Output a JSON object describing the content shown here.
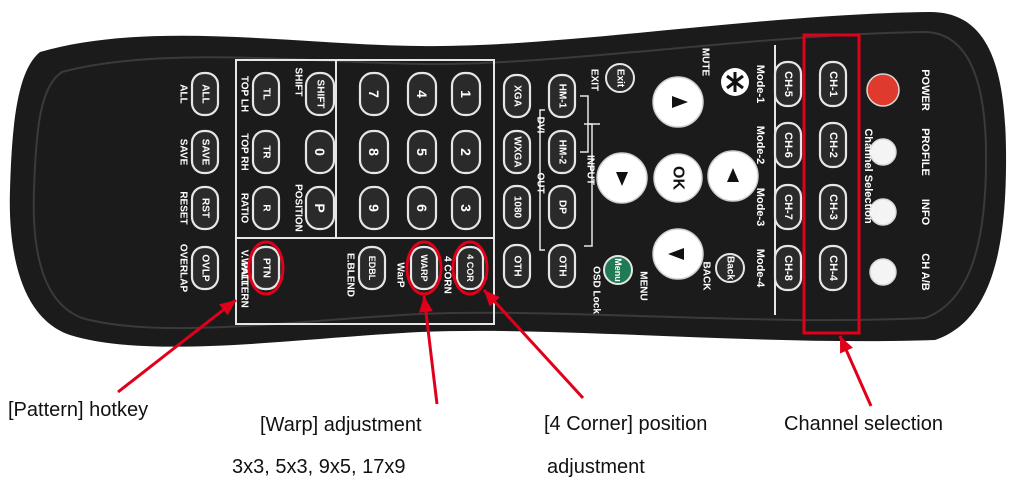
{
  "remote": {
    "top_row": [
      {
        "id": "power",
        "label": "POWER",
        "kind": "round-red"
      },
      {
        "id": "profile",
        "label": "PROFILE",
        "kind": "round-white"
      },
      {
        "id": "info",
        "label": "INFO",
        "kind": "round-white"
      },
      {
        "id": "chab",
        "label": "CH A/B",
        "kind": "round-white"
      }
    ],
    "channel_buttons": [
      {
        "id": "ch1",
        "label": "CH-1"
      },
      {
        "id": "ch2",
        "label": "CH-2"
      },
      {
        "id": "ch3",
        "label": "CH-3"
      },
      {
        "id": "ch4",
        "label": "CH-4"
      }
    ],
    "channel_selection_label": "Channel Selection",
    "mode_buttons": [
      {
        "id": "ch5",
        "label": "CH-5",
        "mode": "Mode-1"
      },
      {
        "id": "ch6",
        "label": "CH-6",
        "mode": "Mode-2"
      },
      {
        "id": "ch7",
        "label": "CH-7",
        "mode": "Mode-3"
      },
      {
        "id": "ch8",
        "label": "CH-8",
        "mode": "Mode-4"
      }
    ],
    "mute": {
      "label": "MUTE"
    },
    "exit": {
      "btn": "Exit",
      "label": "EXIT"
    },
    "back": {
      "btn": "Back",
      "label": "BACK"
    },
    "menu": {
      "btn": "Menu",
      "label": "MENU"
    },
    "osd_lock_label": "OSD Lock",
    "ok": "OK",
    "input_label": "INPUT",
    "dvi_label": "DVI",
    "out_label": "OUT",
    "input_buttons": [
      {
        "id": "hm1",
        "label": "HM-1"
      },
      {
        "id": "hm2",
        "label": "HM-2"
      },
      {
        "id": "dp",
        "label": "DP"
      },
      {
        "id": "oth_in",
        "label": "OTH"
      }
    ],
    "output_buttons": [
      {
        "id": "xga",
        "label": "XGA"
      },
      {
        "id": "wxga",
        "label": "WXGA"
      },
      {
        "id": "p1080",
        "label": "1080"
      },
      {
        "id": "oth_out",
        "label": "OTH"
      }
    ],
    "numbers": [
      [
        "1",
        "2",
        "3"
      ],
      [
        "4",
        "5",
        "6"
      ],
      [
        "7",
        "8",
        "9"
      ],
      [
        "SHIFT",
        "0",
        "P"
      ]
    ],
    "function_keys": [
      {
        "id": "tl",
        "btn": "TL",
        "label": "TOP LH"
      },
      {
        "id": "tr",
        "btn": "TR",
        "label": "TOP RH"
      },
      {
        "id": "r",
        "btn": "R",
        "label": "RATIO"
      },
      {
        "id": "vw",
        "btn": "VW",
        "label": "V.WALL"
      }
    ],
    "shift_label": "SHIFT",
    "position_label": "POSITION",
    "bottom_keys": [
      {
        "id": "all",
        "btn": "ALL",
        "label": "ALL"
      },
      {
        "id": "save",
        "btn": "SAVE",
        "label": "SAVE"
      },
      {
        "id": "rst",
        "btn": "RST",
        "label": "RESET"
      },
      {
        "id": "ovlp",
        "btn": "OVLP",
        "label": "OVERLAP"
      }
    ],
    "warp_keys": [
      {
        "id": "cor",
        "btn": "4 COR",
        "label": "4 CORN"
      },
      {
        "id": "warp",
        "btn": "WARP",
        "label": "WarP"
      },
      {
        "id": "edbl",
        "btn": "EDBL",
        "label": "E.BLEND"
      },
      {
        "id": "ptn",
        "btn": "PTN",
        "label": "PATTERN"
      }
    ]
  },
  "callouts": {
    "pattern": "[Pattern] hotkey",
    "warp_line1": "[Warp] adjustment",
    "warp_line2": "3x3, 5x3, 9x5, 17x9",
    "corner_line1": "[4 Corner] position",
    "corner_line2": "adjustment",
    "channel": "Channel selection"
  },
  "colors": {
    "body": "#1b1b1b",
    "key": "#2a2a2a",
    "key_border": "#e6e6e6",
    "power": "#e03a2e",
    "menu_green": "#1f7a55",
    "highlight": "#e0001a",
    "label": "#ffffff"
  }
}
